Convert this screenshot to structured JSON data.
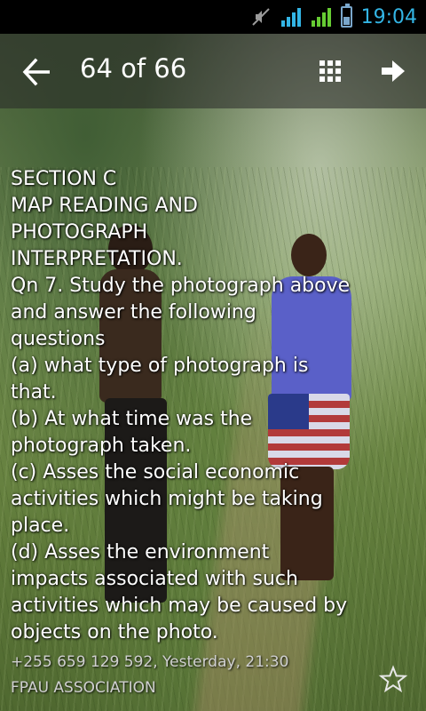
{
  "status_bar": {
    "time": "19:04",
    "icons": [
      "mute-icon",
      "wifi-signal-icon",
      "cell-signal-icon",
      "battery-icon"
    ],
    "accent_color": "#33b5e5"
  },
  "action_bar": {
    "counter": "64 of 66",
    "back_icon": "arrow-left-icon",
    "grid_icon": "grid-icon",
    "next_icon": "arrow-right-icon"
  },
  "message": {
    "lines": [
      "SECTION C",
      "MAP READING AND",
      "PHOTOGRAPH",
      "INTERPRETATION.",
      "Qn 7. Study the photograph above",
      "and answer the following",
      "questions",
      "(a) what type of photograph is",
      "that.",
      "(b) At what time was the",
      "photograph taken.",
      "(c) Asses the social economic",
      "activities which might be taking",
      "place.",
      "(d) Asses the environment",
      "impacts associated with such",
      "activities which may be caused by",
      "objects on the photo."
    ],
    "meta": "+255 659 129 592, Yesterday, 21:30",
    "sender": "FPAU ASSOCIATION",
    "star_icon": "star-outline-icon"
  }
}
